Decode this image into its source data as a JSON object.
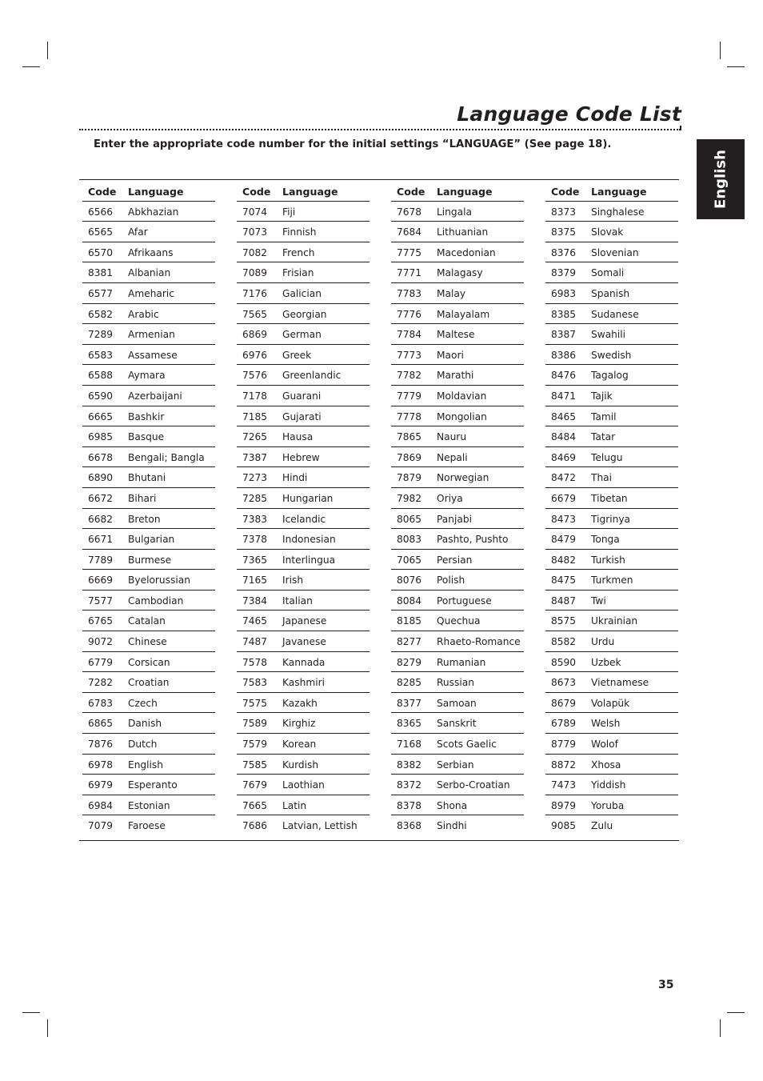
{
  "page": {
    "title": "Language Code List",
    "intro": "Enter the appropriate code number for the initial settings “LANGUAGE” (See page 18).",
    "side_tab": "English",
    "page_number": "35"
  },
  "table": {
    "headers": {
      "code": "Code",
      "language": "Language"
    },
    "columns": [
      [
        {
          "code": "6566",
          "language": "Abkhazian"
        },
        {
          "code": "6565",
          "language": "Afar"
        },
        {
          "code": "6570",
          "language": "Afrikaans"
        },
        {
          "code": "8381",
          "language": "Albanian"
        },
        {
          "code": "6577",
          "language": "Ameharic"
        },
        {
          "code": "6582",
          "language": "Arabic"
        },
        {
          "code": "7289",
          "language": "Armenian"
        },
        {
          "code": "6583",
          "language": "Assamese"
        },
        {
          "code": "6588",
          "language": "Aymara"
        },
        {
          "code": "6590",
          "language": "Azerbaijani"
        },
        {
          "code": "6665",
          "language": "Bashkir"
        },
        {
          "code": "6985",
          "language": "Basque"
        },
        {
          "code": "6678",
          "language": "Bengali; Bangla"
        },
        {
          "code": "6890",
          "language": "Bhutani"
        },
        {
          "code": "6672",
          "language": "Bihari"
        },
        {
          "code": "6682",
          "language": "Breton"
        },
        {
          "code": "6671",
          "language": "Bulgarian"
        },
        {
          "code": "7789",
          "language": "Burmese"
        },
        {
          "code": "6669",
          "language": "Byelorussian"
        },
        {
          "code": "7577",
          "language": "Cambodian"
        },
        {
          "code": "6765",
          "language": "Catalan"
        },
        {
          "code": "9072",
          "language": "Chinese"
        },
        {
          "code": "6779",
          "language": "Corsican"
        },
        {
          "code": "7282",
          "language": "Croatian"
        },
        {
          "code": "6783",
          "language": "Czech"
        },
        {
          "code": "6865",
          "language": "Danish"
        },
        {
          "code": "7876",
          "language": "Dutch"
        },
        {
          "code": "6978",
          "language": "English"
        },
        {
          "code": "6979",
          "language": "Esperanto"
        },
        {
          "code": "6984",
          "language": "Estonian"
        },
        {
          "code": "7079",
          "language": "Faroese"
        }
      ],
      [
        {
          "code": "7074",
          "language": "Fiji"
        },
        {
          "code": "7073",
          "language": "Finnish"
        },
        {
          "code": "7082",
          "language": "French"
        },
        {
          "code": "7089",
          "language": "Frisian"
        },
        {
          "code": "7176",
          "language": "Galician"
        },
        {
          "code": "7565",
          "language": "Georgian"
        },
        {
          "code": "6869",
          "language": "German"
        },
        {
          "code": "6976",
          "language": "Greek"
        },
        {
          "code": "7576",
          "language": "Greenlandic"
        },
        {
          "code": "7178",
          "language": "Guarani"
        },
        {
          "code": "7185",
          "language": "Gujarati"
        },
        {
          "code": "7265",
          "language": "Hausa"
        },
        {
          "code": "7387",
          "language": "Hebrew"
        },
        {
          "code": "7273",
          "language": "Hindi"
        },
        {
          "code": "7285",
          "language": "Hungarian"
        },
        {
          "code": "7383",
          "language": "Icelandic"
        },
        {
          "code": "7378",
          "language": "Indonesian"
        },
        {
          "code": "7365",
          "language": "Interlingua"
        },
        {
          "code": "7165",
          "language": "Irish"
        },
        {
          "code": "7384",
          "language": "Italian"
        },
        {
          "code": "7465",
          "language": "Japanese"
        },
        {
          "code": "7487",
          "language": "Javanese"
        },
        {
          "code": "7578",
          "language": "Kannada"
        },
        {
          "code": "7583",
          "language": "Kashmiri"
        },
        {
          "code": "7575",
          "language": "Kazakh"
        },
        {
          "code": "7589",
          "language": "Kirghiz"
        },
        {
          "code": "7579",
          "language": "Korean"
        },
        {
          "code": "7585",
          "language": "Kurdish"
        },
        {
          "code": "7679",
          "language": "Laothian"
        },
        {
          "code": "7665",
          "language": "Latin"
        },
        {
          "code": "7686",
          "language": "Latvian, Lettish"
        }
      ],
      [
        {
          "code": "7678",
          "language": "Lingala"
        },
        {
          "code": "7684",
          "language": "Lithuanian"
        },
        {
          "code": "7775",
          "language": "Macedonian"
        },
        {
          "code": "7771",
          "language": "Malagasy"
        },
        {
          "code": "7783",
          "language": "Malay"
        },
        {
          "code": "7776",
          "language": "Malayalam"
        },
        {
          "code": "7784",
          "language": "Maltese"
        },
        {
          "code": "7773",
          "language": "Maori"
        },
        {
          "code": "7782",
          "language": "Marathi"
        },
        {
          "code": "7779",
          "language": "Moldavian"
        },
        {
          "code": "7778",
          "language": "Mongolian"
        },
        {
          "code": "7865",
          "language": "Nauru"
        },
        {
          "code": "7869",
          "language": "Nepali"
        },
        {
          "code": "7879",
          "language": "Norwegian"
        },
        {
          "code": "7982",
          "language": "Oriya"
        },
        {
          "code": "8065",
          "language": "Panjabi"
        },
        {
          "code": "8083",
          "language": "Pashto, Pushto"
        },
        {
          "code": "7065",
          "language": "Persian"
        },
        {
          "code": "8076",
          "language": "Polish"
        },
        {
          "code": "8084",
          "language": "Portuguese"
        },
        {
          "code": "8185",
          "language": "Quechua"
        },
        {
          "code": "8277",
          "language": "Rhaeto-Romance"
        },
        {
          "code": "8279",
          "language": "Rumanian"
        },
        {
          "code": "8285",
          "language": "Russian"
        },
        {
          "code": "8377",
          "language": "Samoan"
        },
        {
          "code": "8365",
          "language": "Sanskrit"
        },
        {
          "code": "7168",
          "language": "Scots Gaelic"
        },
        {
          "code": "8382",
          "language": "Serbian"
        },
        {
          "code": "8372",
          "language": "Serbo-Croatian"
        },
        {
          "code": "8378",
          "language": "Shona"
        },
        {
          "code": "8368",
          "language": "Sindhi"
        }
      ],
      [
        {
          "code": "8373",
          "language": "Singhalese"
        },
        {
          "code": "8375",
          "language": "Slovak"
        },
        {
          "code": "8376",
          "language": "Slovenian"
        },
        {
          "code": "8379",
          "language": "Somali"
        },
        {
          "code": "6983",
          "language": "Spanish"
        },
        {
          "code": "8385",
          "language": "Sudanese"
        },
        {
          "code": "8387",
          "language": "Swahili"
        },
        {
          "code": "8386",
          "language": "Swedish"
        },
        {
          "code": "8476",
          "language": "Tagalog"
        },
        {
          "code": "8471",
          "language": "Tajik"
        },
        {
          "code": "8465",
          "language": "Tamil"
        },
        {
          "code": "8484",
          "language": "Tatar"
        },
        {
          "code": "8469",
          "language": "Telugu"
        },
        {
          "code": "8472",
          "language": "Thai"
        },
        {
          "code": "6679",
          "language": "Tibetan"
        },
        {
          "code": "8473",
          "language": "Tigrinya"
        },
        {
          "code": "8479",
          "language": "Tonga"
        },
        {
          "code": "8482",
          "language": "Turkish"
        },
        {
          "code": "8475",
          "language": "Turkmen"
        },
        {
          "code": "8487",
          "language": "Twi"
        },
        {
          "code": "8575",
          "language": "Ukrainian"
        },
        {
          "code": "8582",
          "language": "Urdu"
        },
        {
          "code": "8590",
          "language": "Uzbek"
        },
        {
          "code": "8673",
          "language": "Vietnamese"
        },
        {
          "code": "8679",
          "language": "Volapük"
        },
        {
          "code": "6789",
          "language": "Welsh"
        },
        {
          "code": "8779",
          "language": "Wolof"
        },
        {
          "code": "8872",
          "language": "Xhosa"
        },
        {
          "code": "7473",
          "language": "Yiddish"
        },
        {
          "code": "8979",
          "language": "Yoruba"
        },
        {
          "code": "9085",
          "language": "Zulu"
        }
      ]
    ]
  }
}
